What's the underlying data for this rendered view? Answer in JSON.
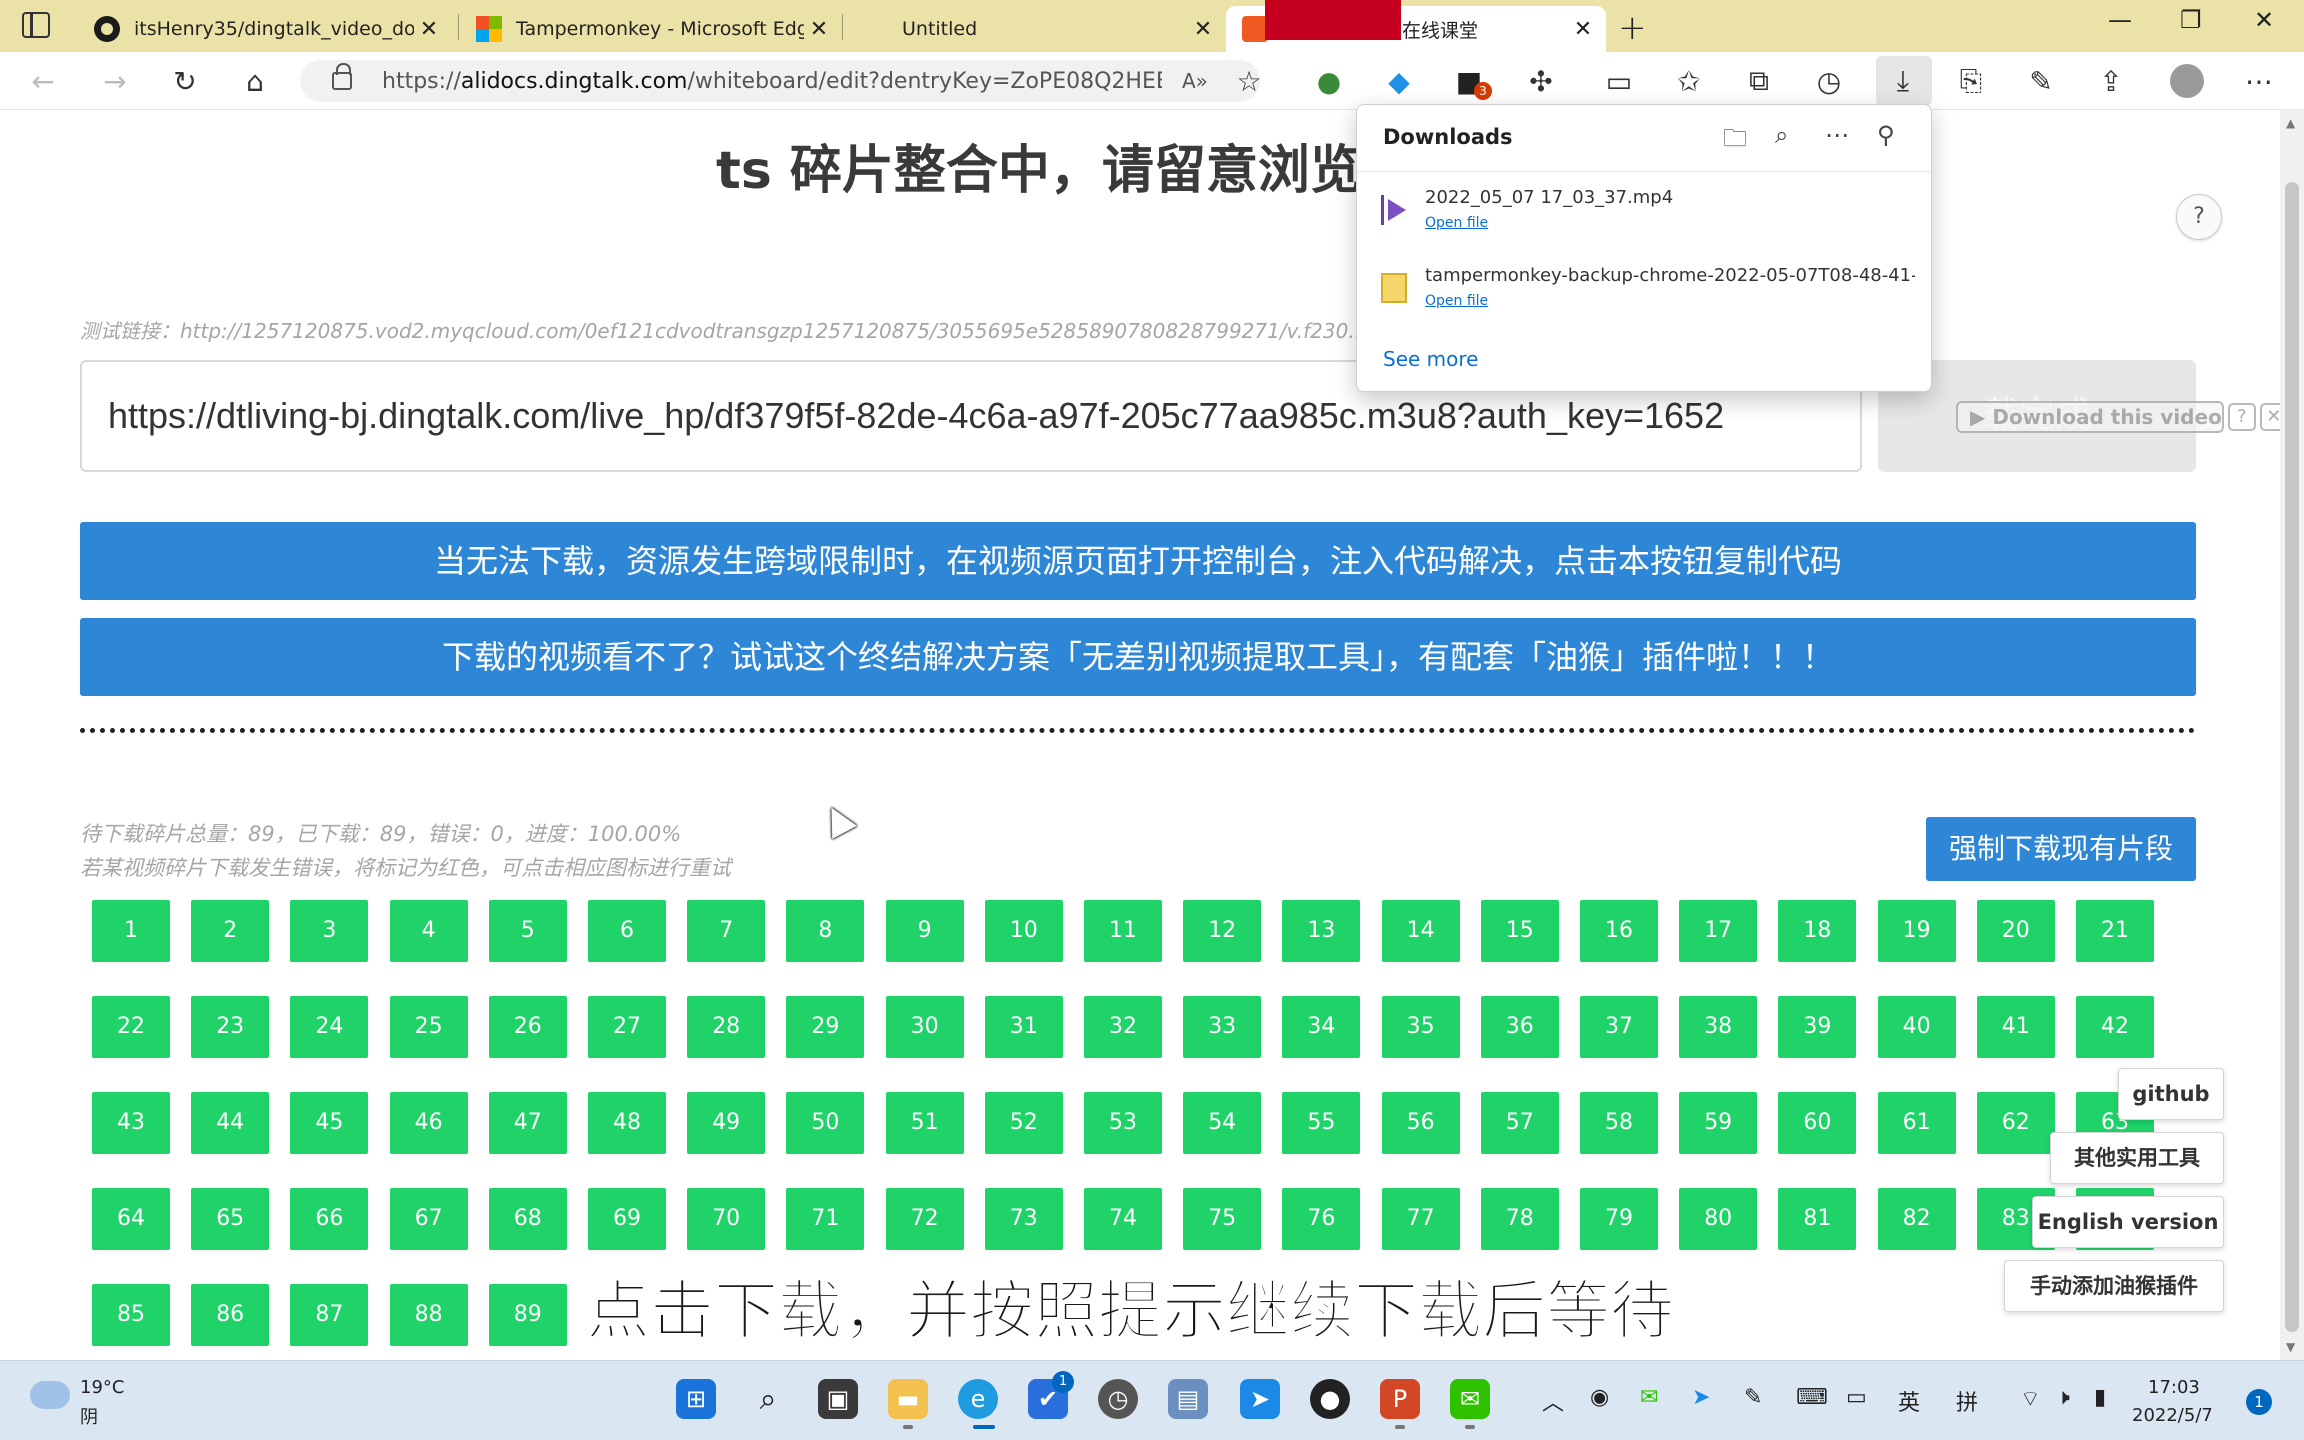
{
  "tabs": [
    {
      "title": "itsHenry35/dingtalk_video_down",
      "icon": "github-icon"
    },
    {
      "title": "Tampermonkey - Microsoft Edge",
      "icon": "microsoft-store-icon"
    },
    {
      "title": "Untitled",
      "icon": ""
    },
    {
      "title": "在线课堂",
      "icon": "dingtalk-icon",
      "active": true
    }
  ],
  "address": {
    "url_prefix": "https://",
    "url_host": "alidocs.dingtalk.com",
    "url_path": "/whiteboard/edit?dentryKey=ZoPE08Q2HEEDqoLO"
  },
  "toolbar": {
    "extension_badge": "3"
  },
  "downloads": {
    "title": "Downloads",
    "items": [
      {
        "name": "2022_05_07 17_03_37.mp4",
        "action": "Open file",
        "icon": "video-file-icon"
      },
      {
        "name": "tampermonkey-backup-chrome-2022-05-07T08-48-41-...",
        "action": "Open file",
        "icon": "zip-file-icon"
      }
    ],
    "see_more": "See more"
  },
  "page": {
    "title": "ts 碎片整合中，请留意浏览",
    "help": "?",
    "test_link": "测试链接：http://1257120875.vod2.myqcloud.com/0ef121cdvodtransgzp1257120875/3055695e5285890780828799271/v.f230.m3u8",
    "input_url": "https://dtliving-bj.dingtalk.com/live_hp/df379f5f-82de-4c6a-a97f-205c77aa985c.m3u8?auth_key=1652",
    "download_button": "载完成",
    "ext_download": "▶ Download this video",
    "ext_help": "?",
    "ext_close": "✕",
    "blue_button_1": "当无法下载，资源发生跨域限制时，在视频源页面打开控制台，注入代码解决，点击本按钮复制代码",
    "blue_button_2": "下载的视频看不了？试试这个终结解决方案「无差别视频提取工具」，有配套「油猴」插件啦！！！",
    "status_line": "待下载碎片总量：89，已下载：89，错误：0，进度：100.00%",
    "status_hint": "若某视频碎片下载发生错误，将标记为红色，可点击相应图标进行重试",
    "force_download": "强制下载现有片段",
    "segments_total": 89,
    "side_buttons": {
      "github": "github",
      "tools": "其他实用工具",
      "english": "English version",
      "manual": "手动添加油猴插件"
    },
    "subtitle": "点击下载，并按照提示继续下载后等待"
  },
  "taskbar": {
    "weather_temp": "19°C",
    "weather_desc": "阴",
    "ime1": "英",
    "ime2": "拼",
    "time": "17:03",
    "date": "2022/5/7",
    "notifications": "1",
    "todo_badge": "1"
  },
  "colors": {
    "tab_strip": "#ebe2a8",
    "primary_blue": "#2d86d6",
    "segment_green": "#1fd369"
  }
}
